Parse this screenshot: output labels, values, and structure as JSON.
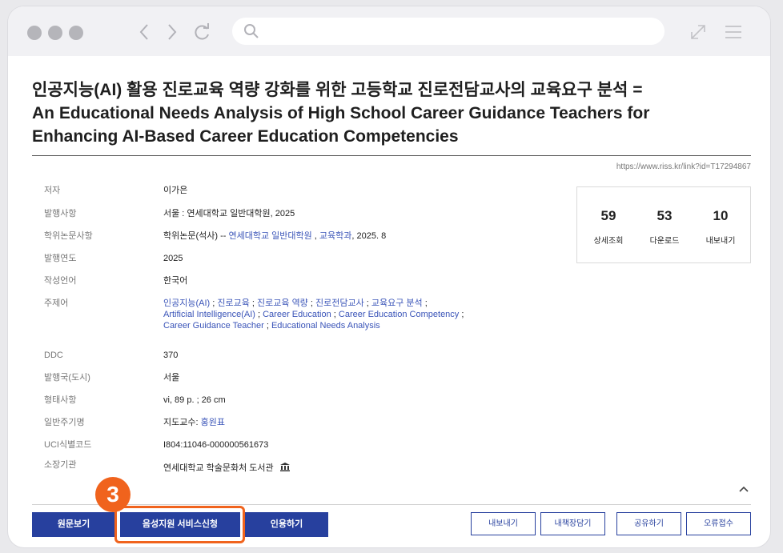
{
  "title": {
    "korean": "인공지능(AI) 활용 진로교육 역량 강화를 위한 고등학교 진로전담교사의 교육요구 분석 =",
    "english_line1": "An Educational Needs Analysis of High School Career Guidance Teachers for",
    "english_line2": "Enhancing AI-Based Career Education Competencies"
  },
  "link_url": "https://www.riss.kr/link?id=T17294867",
  "details": {
    "author": {
      "label": "저자",
      "value": "이가은"
    },
    "publication": {
      "label": "발행사항",
      "value": "서울 : 연세대학교 일반대학원, 2025"
    },
    "thesis": {
      "label": "학위논문사항",
      "prefix": "학위논문(석사) -- ",
      "school_link": "연세대학교 일반대학원",
      "sep": " , ",
      "dept_link": "교육학과",
      "suffix": ", 2025. 8"
    },
    "year": {
      "label": "발행연도",
      "value": "2025"
    },
    "language": {
      "label": "작성언어",
      "value": "한국어"
    },
    "subjects": {
      "label": "주제어",
      "line1": [
        "인공지능(AI)",
        "진로교육",
        "진로교육 역량",
        "진로전담교사",
        "교육요구 분석"
      ],
      "line2": [
        "Artificial Intelligence(AI)",
        "Career Education",
        "Career Education Competency"
      ],
      "line3": [
        "Career Guidance Teacher",
        "Educational Needs Analysis"
      ],
      "separator": " ; "
    },
    "ddc": {
      "label": "DDC",
      "value": "370"
    },
    "country": {
      "label": "발행국(도시)",
      "value": "서울"
    },
    "format": {
      "label": "형태사항",
      "value": "vi, 89 p. ; 26 cm"
    },
    "note": {
      "label": "일반주기명",
      "prefix": "지도교수: ",
      "advisor": "홍원표"
    },
    "uci": {
      "label": "UCI식별코드",
      "value": "I804:11046-000000561673"
    },
    "holding": {
      "label": "소장기관",
      "value": "연세대학교 학술문화처 도서관",
      "icon": "library-icon"
    }
  },
  "stats": [
    {
      "value": "59",
      "label": "상세조회"
    },
    {
      "value": "53",
      "label": "다운로드"
    },
    {
      "value": "10",
      "label": "내보내기"
    }
  ],
  "buttons": {
    "original": "원문보기",
    "voice_service": "음성지원 서비스신청",
    "cite": "인용하기",
    "export": "내보내기",
    "bookshelf": "내책장담기",
    "share": "공유하기",
    "report_error": "오류접수"
  },
  "annotation": {
    "step": "3",
    "color": "#f0631d"
  },
  "colors": {
    "primary": "#27409e",
    "link": "#3a54b8",
    "chrome": "#f1f1f4"
  }
}
